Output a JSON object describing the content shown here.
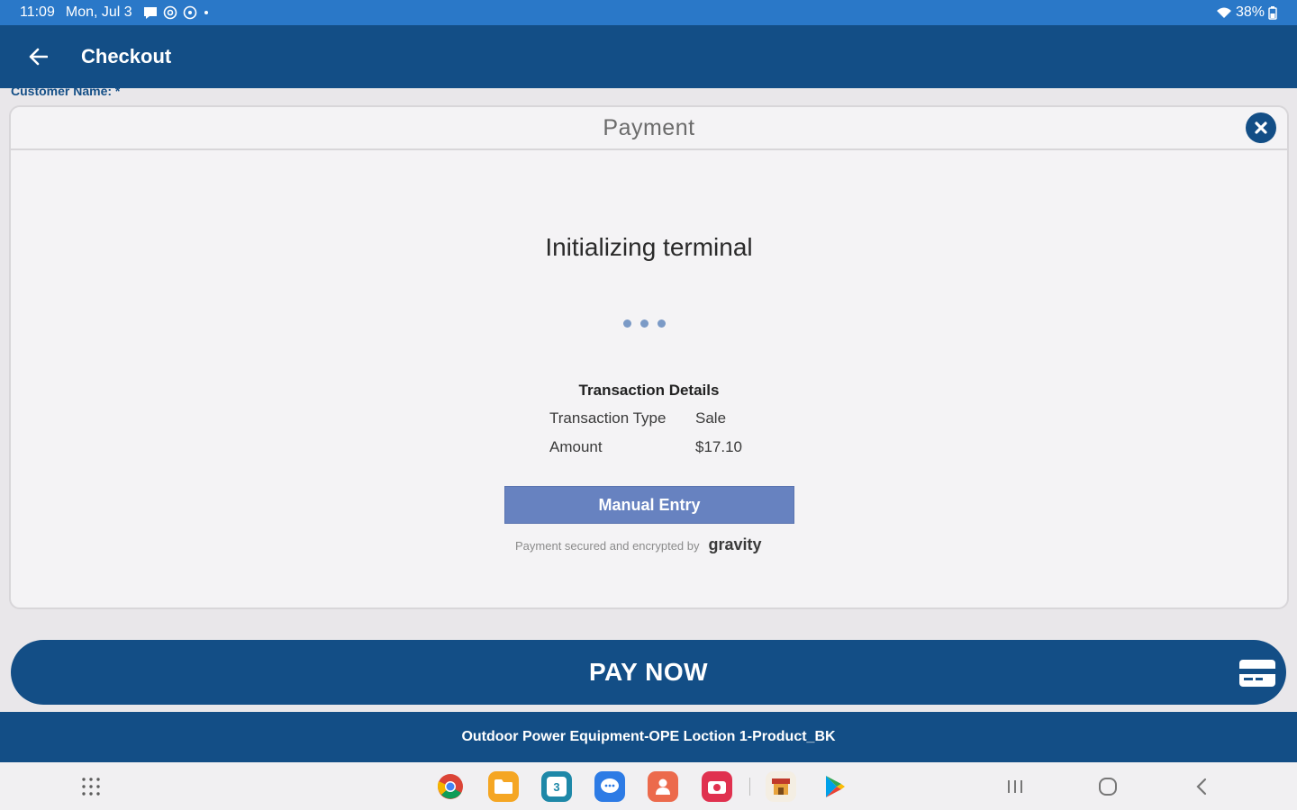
{
  "status_bar": {
    "time": "11:09",
    "date": "Mon, Jul 3",
    "battery": "38%",
    "icons": [
      "message-icon",
      "at-icon",
      "settings-icon",
      "dot-icon",
      "wifi-icon",
      "battery-icon"
    ]
  },
  "app_bar": {
    "title": "Checkout"
  },
  "background": {
    "peek_label": "Customer Name: *"
  },
  "modal": {
    "title": "Payment",
    "status_message": "Initializing terminal",
    "details_title": "Transaction Details",
    "details": [
      {
        "key": "Transaction Type",
        "value": "Sale"
      },
      {
        "key": "Amount",
        "value": "$17.10"
      }
    ],
    "manual_entry_label": "Manual Entry",
    "secured_text": "Payment secured and encrypted by",
    "brand": "gravity"
  },
  "pay_now": {
    "label": "PAY NOW"
  },
  "footer": {
    "location": "Outdoor Power Equipment-OPE Loction 1-Product_BK"
  },
  "nav_bar": {
    "apps": [
      "chrome-icon",
      "files-icon",
      "calendar-icon",
      "messages-icon",
      "contacts-icon",
      "camera-icon",
      "store-icon",
      "play-store-icon"
    ],
    "calendar_day": "3"
  },
  "colors": {
    "primary": "#134e86",
    "status_bar": "#2a78c8",
    "manual_entry": "#6782c0"
  }
}
